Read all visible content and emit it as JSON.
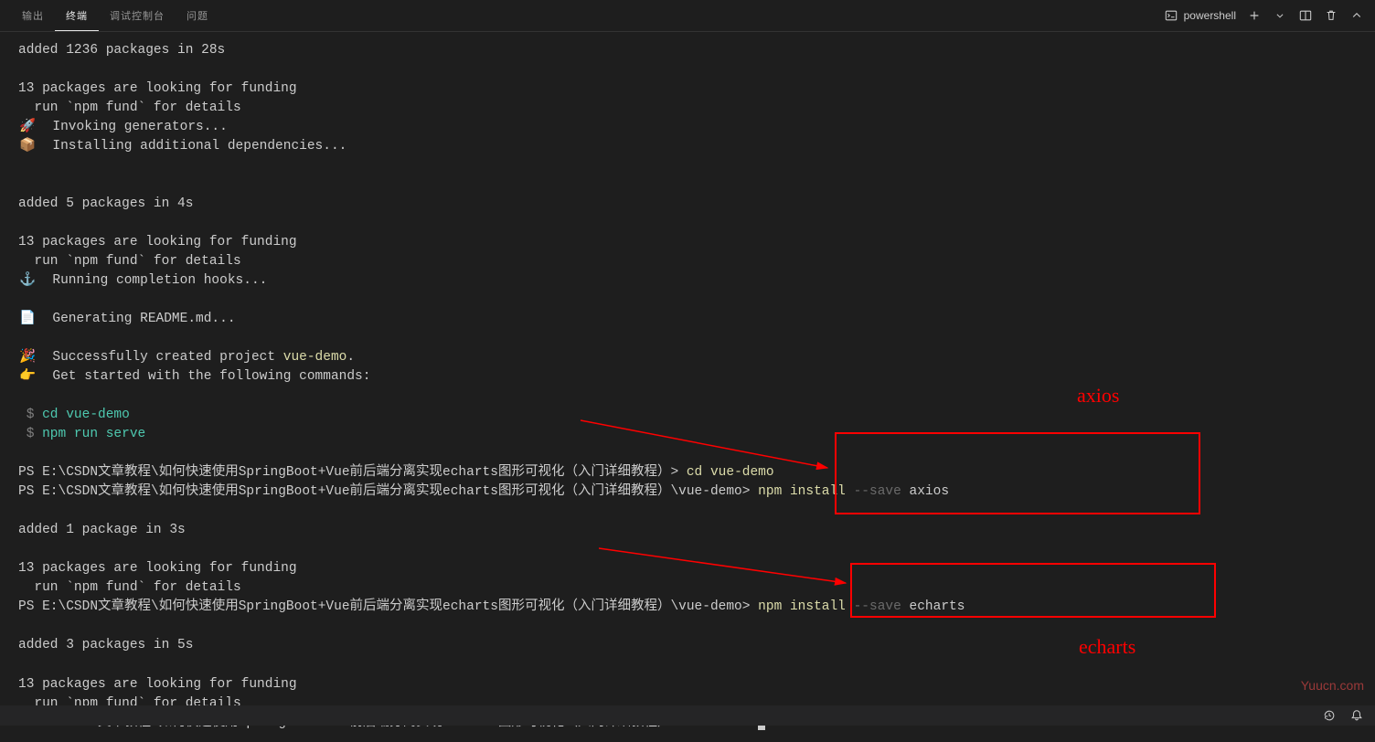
{
  "tabs": {
    "output": "输出",
    "terminal": "终端",
    "debug_console": "调试控制台",
    "problems": "问题"
  },
  "header": {
    "profile_name": "powershell"
  },
  "terminal": {
    "line1": "added 1236 packages in 28s",
    "line2": "",
    "line3": "13 packages are looking for funding",
    "line4": "  run `npm fund` for details",
    "emoji_rocket": "🚀",
    "line5": "  Invoking generators...",
    "emoji_box": "📦",
    "line6": "  Installing additional dependencies...",
    "line7": "",
    "line8": "",
    "line9": "added 5 packages in 4s",
    "line10": "",
    "line11": "13 packages are looking for funding",
    "line12": "  run `npm fund` for details",
    "emoji_anchor": "⚓",
    "line13": "  Running completion hooks...",
    "line14": "",
    "emoji_doc": "📄",
    "line15": "  Generating README.md...",
    "line16": "",
    "emoji_party": "🎉",
    "line17_a": "  Successfully created project ",
    "line17_b": "vue-demo",
    "line17_c": ".",
    "emoji_point": "👉",
    "line18": "  Get started with the following commands:",
    "line19": "",
    "prompt_dollar": " $",
    "cmd_cd": " cd vue-demo",
    "cmd_serve": " npm run serve",
    "line20": "",
    "ps1_a": "PS E:\\CSDN文章教程\\如何快速使用SpringBoot+Vue前后端分离实现echarts图形可视化（入门详细教程）> ",
    "ps1_b": "cd vue-demo",
    "ps2_a": "PS E:\\CSDN文章教程\\如何快速使用SpringBoot+Vue前后端分离实现echarts图形可视化（入门详细教程）\\vue-demo> ",
    "ps2_b": "npm install ",
    "ps2_c": "--save",
    "ps2_d": " axios",
    "line21": "",
    "line22": "added 1 package in 3s",
    "line23": "",
    "line24": "13 packages are looking for funding",
    "line25": "  run `npm fund` for details",
    "ps3_a": "PS E:\\CSDN文章教程\\如何快速使用SpringBoot+Vue前后端分离实现echarts图形可视化（入门详细教程）\\vue-demo> ",
    "ps3_b": "npm install ",
    "ps3_c": "--save",
    "ps3_d": " echarts",
    "line26": "",
    "line27": "added 3 packages in 5s",
    "line28": "",
    "line29": "13 packages are looking for funding",
    "line30": "  run `npm fund` for details",
    "ps4": "PS E:\\CSDN文章教程\\如何快速使用SpringBoot+Vue前后端分离实现echarts图形可视化（入门详细教程）\\vue-demo> "
  },
  "annotations": {
    "label_axios": "axios",
    "label_echarts": "echarts"
  },
  "watermark": "Yuucn.com"
}
